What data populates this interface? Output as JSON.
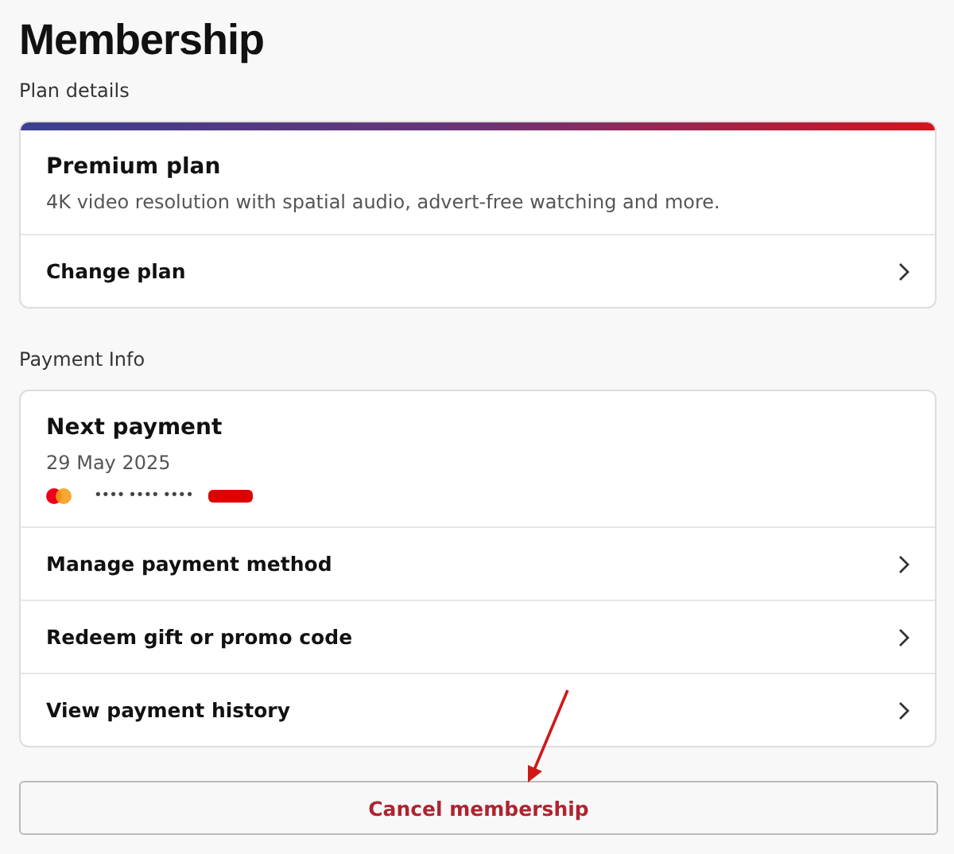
{
  "title": "Membership",
  "plan_section": {
    "label": "Plan details",
    "plan_name": "Premium plan",
    "description": "4K video resolution with spatial audio, advert-free watching and more.",
    "actions": [
      {
        "label": "Change plan"
      }
    ]
  },
  "payment_section": {
    "label": "Payment Info",
    "next_payment_label": "Next payment",
    "date": "29 May 2025",
    "card_number": "•••• •••• ••••",
    "actions": [
      {
        "label": "Manage payment method"
      },
      {
        "label": "Redeem gift or promo code"
      },
      {
        "label": "View payment history"
      }
    ]
  },
  "cancel_button": "Cancel membership"
}
